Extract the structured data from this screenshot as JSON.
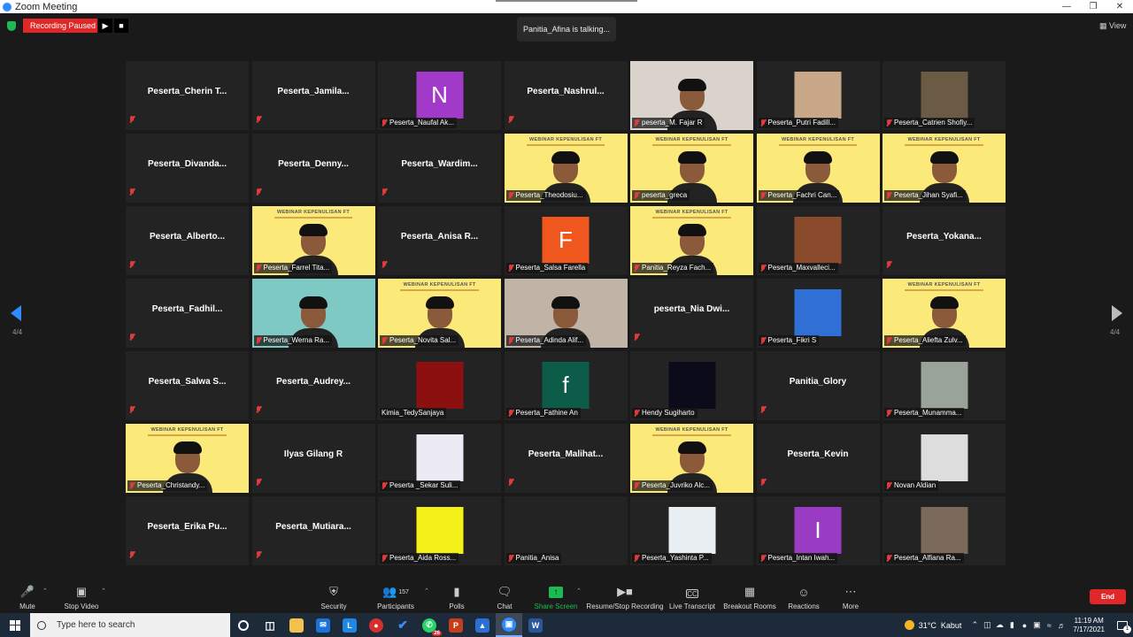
{
  "window": {
    "title": "Zoom Meeting"
  },
  "recording": {
    "status": "Recording Paused",
    "resume_icon": "play-icon",
    "stop_icon": "stop-icon"
  },
  "talking": "Panitia_Afina is talking...",
  "view_label": "View",
  "pagination": {
    "left": "4/4",
    "right": "4/4"
  },
  "tiles": [
    {
      "kind": "name",
      "name": "Peserta_Cherin  T..."
    },
    {
      "kind": "name",
      "name": "Peserta_Jamila..."
    },
    {
      "kind": "avatar",
      "letter": "N",
      "color": "#a23ac9",
      "label": "Peserta_Naufal Ak..."
    },
    {
      "kind": "name",
      "name": "Peserta_Nashrul..."
    },
    {
      "kind": "video",
      "bg": "#d9d3cc",
      "label": "peserta_M. Fajar R"
    },
    {
      "kind": "image",
      "bg": "#f4ece6",
      "img": "#c9a88a",
      "label": "Peserta_Putri Fadill..."
    },
    {
      "kind": "image",
      "bg": "#232323",
      "img": "#6b5a44",
      "label": "Peserta_Catrien Shofiy..."
    },
    {
      "kind": "name",
      "name": "Peserta_Divanda..."
    },
    {
      "kind": "name",
      "name": "Peserta_Denny..."
    },
    {
      "kind": "name",
      "name": "Peserta_Wardim..."
    },
    {
      "kind": "banner",
      "label": "Peserta_Theodosiu..."
    },
    {
      "kind": "banner",
      "label": "peserta_greca"
    },
    {
      "kind": "banner",
      "label": "Peserta_Fachri Can..."
    },
    {
      "kind": "banner",
      "label": "Peserta_Jihan Syafi..."
    },
    {
      "kind": "name",
      "name": "Peserta_Alberto..."
    },
    {
      "kind": "banner",
      "label": "Peserta_Farrel Tita..."
    },
    {
      "kind": "name",
      "name": "Peserta_Anisa  R..."
    },
    {
      "kind": "avatar",
      "letter": "F",
      "color": "#f0571e",
      "label": "Peserta_Salsa Farella"
    },
    {
      "kind": "banner",
      "label": "Panitia_Reyza Fach..."
    },
    {
      "kind": "image",
      "bg": "#232323",
      "img": "#8a4b2c",
      "label": "Peserta_Maxvalleci..."
    },
    {
      "kind": "name",
      "name": "Peserta_Yokana..."
    },
    {
      "kind": "name",
      "name": "Peserta_Fadhil..."
    },
    {
      "kind": "video",
      "bg": "#7ec9c3",
      "label": "Peserta_Werna Ra..."
    },
    {
      "kind": "banner",
      "label": "Peserta_Novita Sal..."
    },
    {
      "kind": "video",
      "bg": "#bfb4a6",
      "label": "Peserta_Adinda Alif..."
    },
    {
      "kind": "name",
      "name": "peserta_Nia  Dwi..."
    },
    {
      "kind": "image",
      "bg": "#232323",
      "img": "#2f6fd6",
      "label": "Peserta_Fikri S"
    },
    {
      "kind": "banner",
      "label": "Peserta_Aliefta Zulv..."
    },
    {
      "kind": "name",
      "name": "Peserta_Salwa  S..."
    },
    {
      "kind": "name",
      "name": "Peserta_Audrey..."
    },
    {
      "kind": "image",
      "bg": "#232323",
      "img": "#8c1010",
      "label": "Kimia_TedySanjaya",
      "unmuted": true
    },
    {
      "kind": "avatar",
      "letter": "f",
      "color": "#0d5c4a",
      "label": "Peserta_Fathine An"
    },
    {
      "kind": "image",
      "bg": "#232323",
      "img": "#0b0b1a",
      "label": "Hendy Sugiharto"
    },
    {
      "kind": "name",
      "name": "Panitia_Glory"
    },
    {
      "kind": "image",
      "bg": "#232323",
      "img": "#9aa39a",
      "label": "Peserta_Munamma..."
    },
    {
      "kind": "banner",
      "label": "Peserta_Christandy..."
    },
    {
      "kind": "name",
      "name": "Ilyas Gilang R",
      "solo_mic": false
    },
    {
      "kind": "image",
      "bg": "#232323",
      "img": "#ecebf5",
      "label": "Peserta _Sekar Suli..."
    },
    {
      "kind": "name",
      "name": "Peserta_Malihat..."
    },
    {
      "kind": "banner",
      "label": "Peserta_Juvriko Alc..."
    },
    {
      "kind": "name",
      "name": "Peserta_Kevin"
    },
    {
      "kind": "image",
      "bg": "#232323",
      "img": "#dddddd",
      "label": "Novan Aldian"
    },
    {
      "kind": "name",
      "name": "Peserta_Erika  Pu..."
    },
    {
      "kind": "name",
      "name": "Peserta_Mutiara..."
    },
    {
      "kind": "image",
      "bg": "#232323",
      "img": "#f4f01a",
      "label": "Peserta_Aida Ross..."
    },
    {
      "kind": "label_only",
      "label": "Panitia_Anisa"
    },
    {
      "kind": "image",
      "bg": "#232323",
      "img": "#e9eef2",
      "label": "Peserta_Yashinta P..."
    },
    {
      "kind": "avatar",
      "letter": "I",
      "color": "#9a3bc4",
      "label": "Peserta_Intan Iwah..."
    },
    {
      "kind": "image",
      "bg": "#232323",
      "img": "#7b6a5a",
      "label": "Peserta_Alfiana Ra..."
    }
  ],
  "banner_text": "WEBINAR KEPENULISAN FT",
  "toolbar": {
    "mute": "Mute",
    "stop_video": "Stop Video",
    "security": "Security",
    "participants": "Participants",
    "participant_count": "157",
    "polls": "Polls",
    "chat": "Chat",
    "share_screen": "Share Screen",
    "resume_stop_recording": "Resume/Stop Recording",
    "live_transcript": "Live Transcript",
    "breakout_rooms": "Breakout Rooms",
    "reactions": "Reactions",
    "more": "More",
    "end": "End"
  },
  "taskbar": {
    "search_placeholder": "Type here to search",
    "weather_temp": "31°C",
    "weather_desc": "Kabut",
    "time": "11:19 AM",
    "date": "7/17/2021",
    "notification_count": "1",
    "whatsapp_badge": "26"
  }
}
